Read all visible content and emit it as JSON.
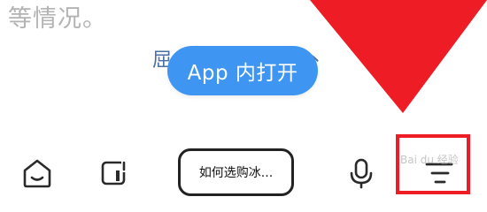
{
  "article": {
    "text": "等情况。",
    "partial_left": "屈",
    "partial_right": "丶"
  },
  "open_app": {
    "label": "App 内打开"
  },
  "bottom_bar": {
    "search_text": "如何选购冰...",
    "icons": [
      "home-icon",
      "window-icon",
      "mic-icon",
      "menu-icon"
    ]
  },
  "annotation": {
    "highlight_color": "#ee1c24",
    "watermark": "Bai du 经验"
  },
  "colors": {
    "accent": "#3f95f2",
    "annotation_red": "#ee1c24",
    "text_muted": "#b3b3b3"
  }
}
